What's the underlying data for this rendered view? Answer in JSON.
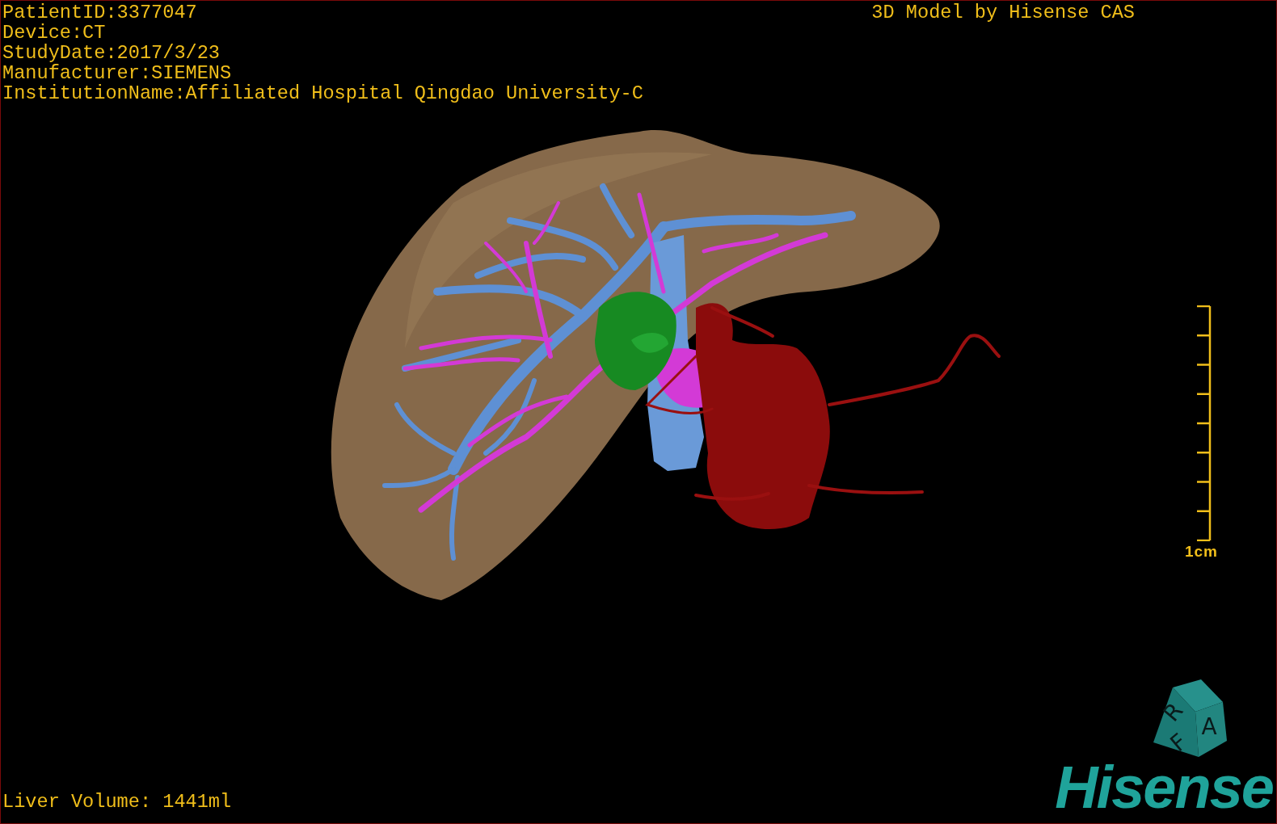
{
  "info_lines": [
    "PatientID:3377047",
    "Device:CT",
    "StudyDate:2017/3/23",
    "Manufacturer:SIEMENS",
    "InstitutionName:Affiliated Hospital Qingdao University-C"
  ],
  "title": "3D Model by Hisense CAS",
  "scale_bar": {
    "label": "1cm"
  },
  "orientation_cube": {
    "faces": [
      "A",
      "R",
      "F"
    ]
  },
  "liver_volume": "Liver Volume: 1441ml",
  "logo": "Hisense"
}
